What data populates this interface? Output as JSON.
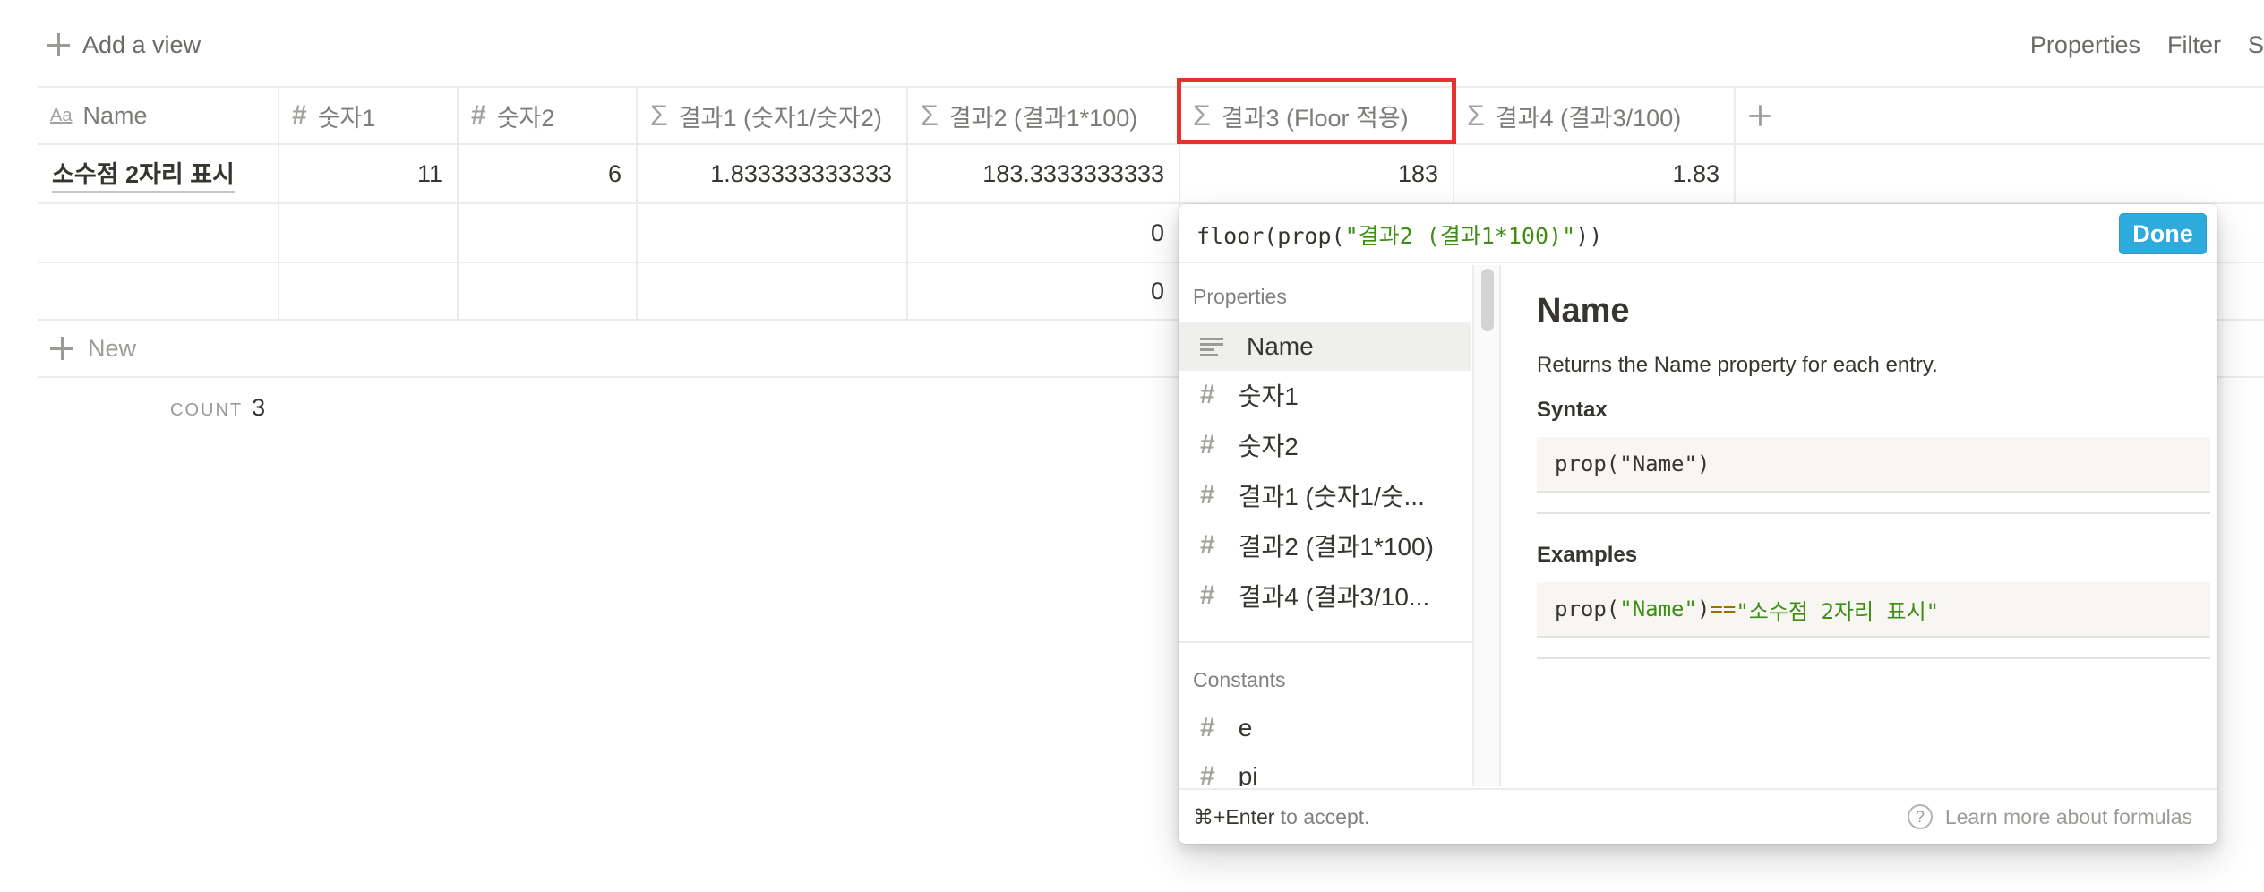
{
  "toolbar": {
    "add_view_label": "Add a view",
    "properties_label": "Properties",
    "filter_label": "Filter",
    "sort_label_truncated": "S"
  },
  "table": {
    "columns": [
      {
        "icon": "text-icon",
        "label": "Name"
      },
      {
        "icon": "number-icon",
        "label": "숫자1"
      },
      {
        "icon": "number-icon",
        "label": "숫자2"
      },
      {
        "icon": "formula-icon",
        "label": "결과1 (숫자1/숫자2)"
      },
      {
        "icon": "formula-icon",
        "label": "결과2 (결과1*100)"
      },
      {
        "icon": "formula-icon",
        "label": "결과3 (Floor 적용)"
      },
      {
        "icon": "formula-icon",
        "label": "결과4 (결과3/100)"
      }
    ],
    "rows": [
      [
        "소수점 2자리 표시",
        "11",
        "6",
        "1.833333333333",
        "183.3333333333",
        "183",
        "1.83"
      ],
      [
        "",
        "",
        "",
        "",
        "0",
        "",
        ""
      ],
      [
        "",
        "",
        "",
        "",
        "0",
        "",
        ""
      ]
    ],
    "new_label": "New",
    "count_label": "COUNT",
    "count_value": "3"
  },
  "formula_editor": {
    "prefix": "floor(prop(",
    "arg": "\"결과2 (결과1*100)\"",
    "suffix": "))",
    "done_label": "Done",
    "properties_title": "Properties",
    "properties": [
      {
        "icon": "text-icon",
        "label": "Name"
      },
      {
        "icon": "number-icon",
        "label": "숫자1"
      },
      {
        "icon": "number-icon",
        "label": "숫자2"
      },
      {
        "icon": "number-icon",
        "label": "결과1 (숫자1/숫..."
      },
      {
        "icon": "number-icon",
        "label": "결과2 (결과1*100)"
      },
      {
        "icon": "number-icon",
        "label": "결과4 (결과3/10..."
      }
    ],
    "constants_title": "Constants",
    "constants": [
      {
        "icon": "number-icon",
        "label": "e"
      },
      {
        "icon": "number-icon",
        "label": "pi"
      }
    ],
    "doc": {
      "title": "Name",
      "description": "Returns the Name property for each entry.",
      "syntax_heading": "Syntax",
      "syntax_fn": "prop(",
      "syntax_arg": "\"Name\"",
      "syntax_end": ")",
      "examples_heading": "Examples",
      "example_fn": "prop(",
      "example_arg": "\"Name\"",
      "example_mid": ") ",
      "example_op": "==",
      "example_val": " \"소수점 2자리 표시\""
    },
    "footer_shortcut": "⌘+Enter",
    "footer_accept": " to accept.",
    "footer_help": "Learn more about formulas"
  },
  "colors": {
    "highlight_box": "#e5322d",
    "done_button": "#2eaadc",
    "string_literal": "#3d8f12"
  }
}
